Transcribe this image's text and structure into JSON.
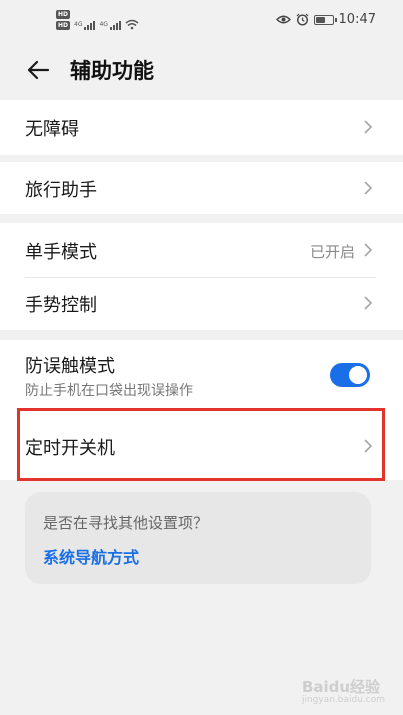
{
  "status_bar": {
    "hd_1": "HD",
    "hd_2": "HD",
    "net_1": "4G",
    "net_2": "4G",
    "time": "10:47",
    "battery_level": 0.6
  },
  "header": {
    "title": "辅助功能"
  },
  "items": {
    "accessibility": {
      "label": "无障碍"
    },
    "travel_assistant": {
      "label": "旅行助手"
    },
    "one_hand_mode": {
      "label": "单手模式",
      "value": "已开启"
    },
    "gesture_control": {
      "label": "手势控制"
    },
    "accidental_touch": {
      "label": "防误触模式",
      "sublabel": "防止手机在口袋出现误操作",
      "enabled": true
    },
    "scheduled_power": {
      "label": "定时开关机"
    }
  },
  "suggestion": {
    "question": "是否在寻找其他设置项？",
    "link": "系统导航方式"
  },
  "watermark": {
    "brand": "Baidu经验",
    "domain": "jingyan.baidu.com"
  },
  "colors": {
    "accent": "#1a6fe8",
    "highlight": "#e3332d",
    "background": "#f1f1f1"
  }
}
